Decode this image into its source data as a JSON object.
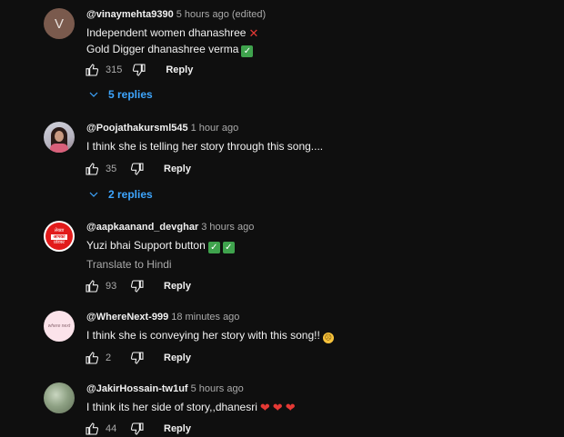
{
  "comments": [
    {
      "avatar_initial": "V",
      "author": "@vinaymehta9390",
      "time": "5 hours ago (edited)",
      "lines": [
        "Independent women dhanashree",
        "Gold Digger dhanashree verma"
      ],
      "likes": "315",
      "reply_label": "Reply",
      "replies_label": "5 replies"
    },
    {
      "author": "@Poojathakursml545",
      "time": "1 hour ago",
      "lines": [
        "I think she is telling her story through this song...."
      ],
      "likes": "35",
      "reply_label": "Reply",
      "replies_label": "2 replies"
    },
    {
      "avatar_text": [
        "लेख्या",
        "आपका",
        "प्रोडक्ट"
      ],
      "author": "@aapkaanand_devghar",
      "time": "3 hours ago",
      "lines": [
        "Yuzi bhai Support button"
      ],
      "translate_label": "Translate to Hindi",
      "likes": "93",
      "reply_label": "Reply"
    },
    {
      "avatar_text": "where next",
      "author": "@WhereNext-999",
      "time": "18 minutes ago",
      "lines": [
        "I think she is conveying her story with this song!!"
      ],
      "likes": "2",
      "reply_label": "Reply"
    },
    {
      "author": "@JakirHossain-tw1uf",
      "time": "5 hours ago",
      "lines": [
        "I think its her side of story,,dhanesri"
      ],
      "likes": "44",
      "reply_label": "Reply"
    }
  ],
  "colors": {
    "background": "#0f0f0f",
    "link": "#3ea6ff",
    "secondary_text": "#aaaaaa"
  },
  "icons": [
    "like-icon",
    "dislike-icon",
    "chevron-down-icon",
    "cross-mark-emoji",
    "check-mark-emoji",
    "sad-face-emoji",
    "heart-emoji"
  ]
}
